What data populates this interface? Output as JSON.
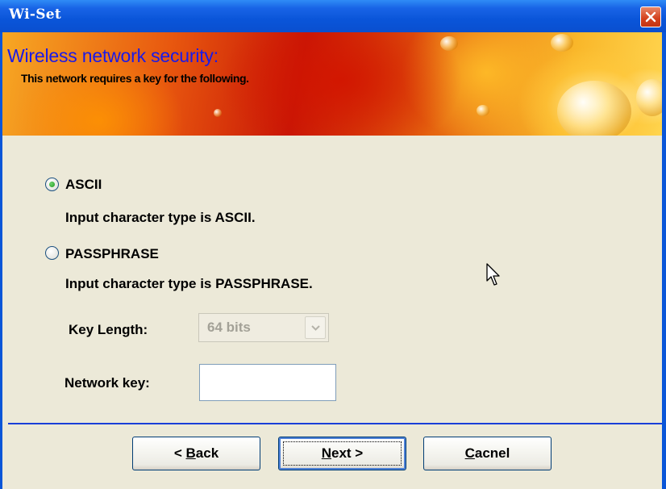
{
  "window": {
    "title": "Wi-Set",
    "close_icon": "close-icon"
  },
  "banner": {
    "title": "Wireless network security:",
    "subtitle": "This network requires a key for the following."
  },
  "options": [
    {
      "label": "ASCII",
      "description": "Input character type is ASCII.",
      "checked": true
    },
    {
      "label": "PASSPHRASE",
      "description": "Input character type is PASSPHRASE.",
      "checked": false
    }
  ],
  "key_length": {
    "label": "Key Length:",
    "value": "64 bits",
    "disabled": true
  },
  "network_key": {
    "label": "Network key:",
    "value": ""
  },
  "buttons": {
    "back": {
      "prefix": "< ",
      "mnemonic": "B",
      "rest": "ack"
    },
    "next": {
      "mnemonic": "N",
      "rest": "ext >"
    },
    "cancel": {
      "mnemonic": "C",
      "rest": "acnel"
    }
  },
  "colors": {
    "title_bar": "#0a55d9",
    "banner_title": "#1a1ae8",
    "client_bg": "#ece9d8",
    "separator": "#1a3fd8"
  }
}
